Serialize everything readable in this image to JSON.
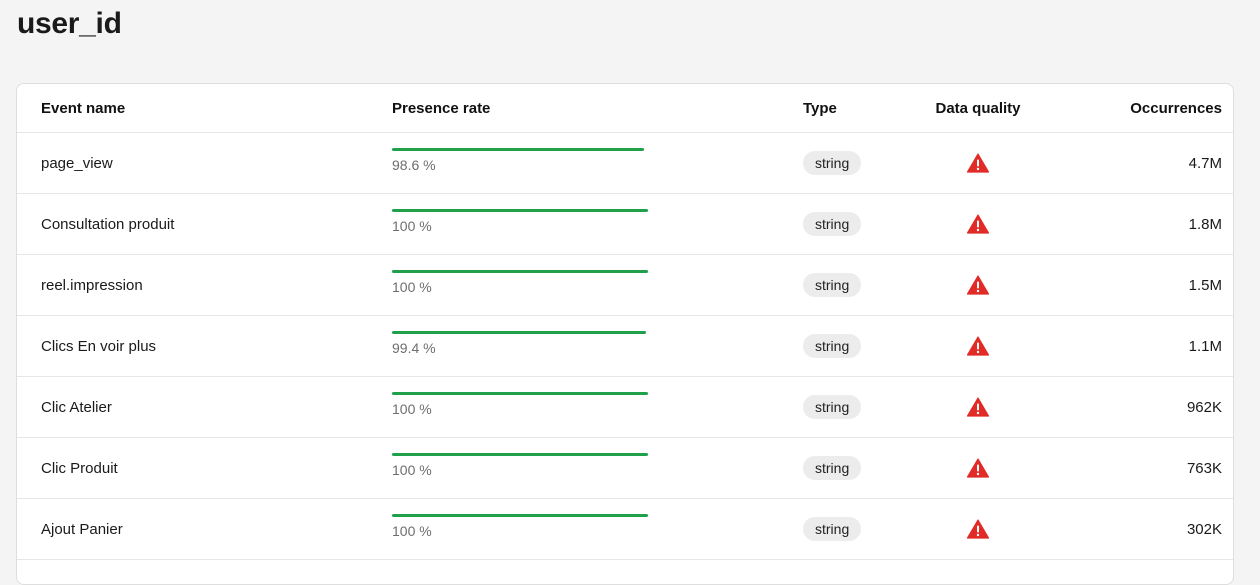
{
  "page": {
    "title": "user_id"
  },
  "table": {
    "columns": {
      "event_name": "Event name",
      "presence_rate": "Presence rate",
      "type": "Type",
      "data_quality": "Data quality",
      "occurrences": "Occurrences"
    },
    "rows": [
      {
        "event_name": "page_view",
        "presence_label": "98.6 %",
        "presence_value": 98.6,
        "type": "string",
        "quality_icon": "warning-triangle-icon",
        "occurrences": "4.7M"
      },
      {
        "event_name": "Consultation produit",
        "presence_label": "100 %",
        "presence_value": 100,
        "type": "string",
        "quality_icon": "warning-triangle-icon",
        "occurrences": "1.8M"
      },
      {
        "event_name": "reel.impression",
        "presence_label": "100 %",
        "presence_value": 100,
        "type": "string",
        "quality_icon": "warning-triangle-icon",
        "occurrences": "1.5M"
      },
      {
        "event_name": "Clics En voir plus",
        "presence_label": "99.4 %",
        "presence_value": 99.4,
        "type": "string",
        "quality_icon": "warning-triangle-icon",
        "occurrences": "1.1M"
      },
      {
        "event_name": "Clic Atelier",
        "presence_label": "100 %",
        "presence_value": 100,
        "type": "string",
        "quality_icon": "warning-triangle-icon",
        "occurrences": "962K"
      },
      {
        "event_name": "Clic Produit",
        "presence_label": "100 %",
        "presence_value": 100,
        "type": "string",
        "quality_icon": "warning-triangle-icon",
        "occurrences": "763K"
      },
      {
        "event_name": "Ajout Panier",
        "presence_label": "100 %",
        "presence_value": 100,
        "type": "string",
        "quality_icon": "warning-triangle-icon",
        "occurrences": "302K"
      }
    ]
  },
  "colors": {
    "presence_bar": "#20a04a",
    "warning": "#e02b27",
    "type_pill_bg": "#ececec"
  }
}
